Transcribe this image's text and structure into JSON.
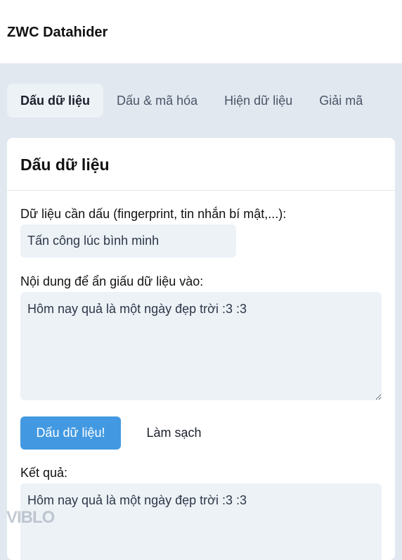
{
  "app": {
    "title": "ZWC Datahider"
  },
  "tabs": [
    {
      "label": "Dấu dữ liệu",
      "active": true
    },
    {
      "label": "Dấu & mã hóa",
      "active": false
    },
    {
      "label": "Hiện dữ liệu",
      "active": false
    },
    {
      "label": "Giải mã",
      "active": false
    }
  ],
  "card": {
    "title": "Dấu dữ liệu",
    "secret_label": "Dữ liệu cần dấu (fingerprint, tin nhắn bí mật,...):",
    "secret_value": "Tấn công lúc bình minh",
    "cover_label": "Nội dung để ẩn giấu dữ liệu vào:",
    "cover_value": "Hôm nay quả là một ngày đẹp trời :3 :3",
    "hide_button": "Dấu dữ liệu!",
    "clear_button": "Làm sạch",
    "result_label": "Kết quả:",
    "result_value": "Hôm nay quả là một ngày đẹp trời :3 :3"
  },
  "watermark": "VIBLO",
  "colors": {
    "background": "#e2e8f0",
    "primary": "#4299e1",
    "input_bg": "#edf2f7"
  }
}
